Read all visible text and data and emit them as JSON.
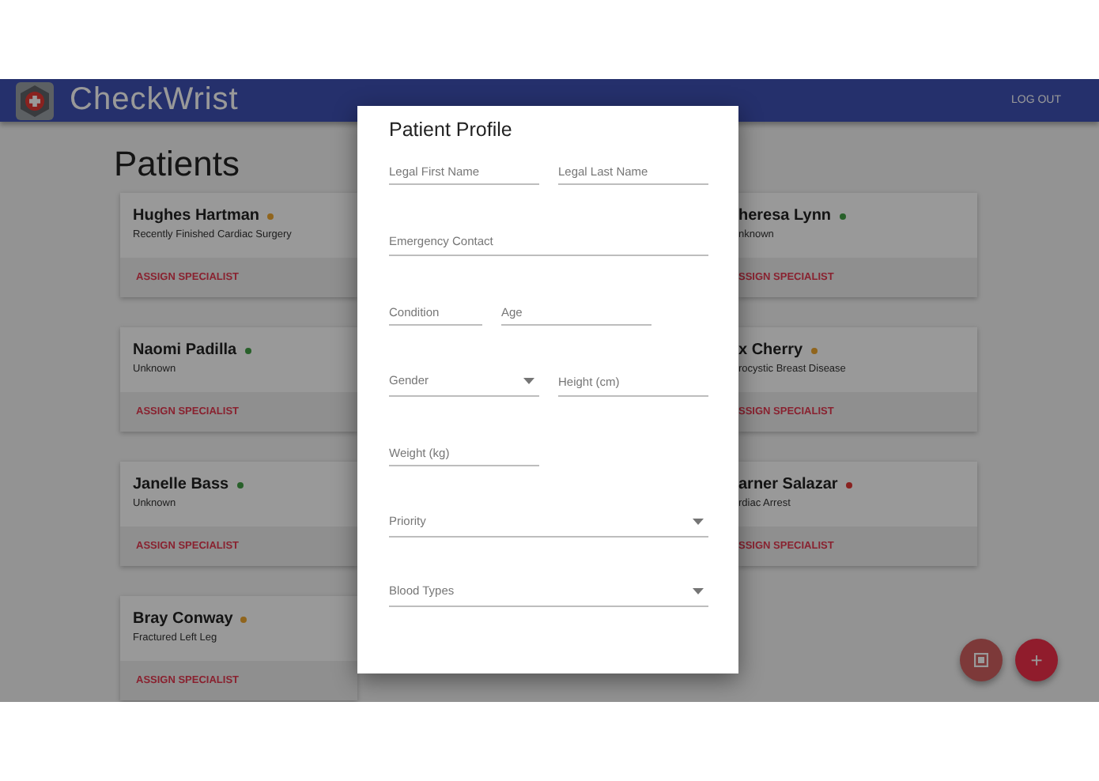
{
  "header": {
    "app_name": "CheckWrist",
    "logout": "LOG OUT"
  },
  "page_title": "Patients",
  "left_cards": [
    {
      "name": "Hughes Hartman",
      "color": "#90651d",
      "condition": "Recently Finished Cardiac Surgery",
      "action": "ASSIGN SPECIALIST"
    },
    {
      "name": "Naomi Padilla",
      "color": "#28602a",
      "condition": "Unknown",
      "action": "ASSIGN SPECIALIST"
    },
    {
      "name": "Janelle Bass",
      "color": "#28602a",
      "condition": "Unknown",
      "action": "ASSIGN SPECIALIST"
    },
    {
      "name": "Bray Conway",
      "color": "#90651d",
      "condition": "Fractured Left Leg",
      "action": "ASSIGN SPECIALIST"
    }
  ],
  "right_cards": [
    {
      "name": "heresa Lynn",
      "color": "#28602a",
      "condition": "nknown",
      "action": "SSIGN SPECIALIST"
    },
    {
      "name": "x Cherry",
      "color": "#90651d",
      "condition": "rocystic Breast Disease",
      "action": "SSIGN SPECIALIST"
    },
    {
      "name": "arner Salazar",
      "color": "#892220",
      "condition": "rdiac Arrest",
      "action": "SSIGN SPECIALIST"
    }
  ],
  "fab_add": "+",
  "dialog": {
    "title": "Patient Profile",
    "rows": [
      {
        "fields": [
          {
            "placeholder": "Legal First Name",
            "kind": "text"
          },
          {
            "placeholder": "Legal Last Name",
            "kind": "text"
          }
        ]
      },
      {
        "fields": [
          {
            "placeholder": "Emergency Contact",
            "kind": "text"
          }
        ]
      },
      {
        "fields": [
          {
            "placeholder": "Condition",
            "kind": "text"
          },
          {
            "placeholder": "Age",
            "kind": "text"
          }
        ]
      },
      {
        "fields": [
          {
            "placeholder": "Gender",
            "kind": "select"
          },
          {
            "placeholder": "Height (cm)",
            "kind": "text"
          }
        ]
      },
      {
        "fields": [
          {
            "placeholder": "Weight (kg)",
            "kind": "text"
          }
        ]
      },
      {
        "fields": [
          {
            "placeholder": "Priority",
            "kind": "select"
          }
        ]
      },
      {
        "fields": [
          {
            "placeholder": "Blood Types",
            "kind": "select"
          }
        ]
      }
    ]
  }
}
